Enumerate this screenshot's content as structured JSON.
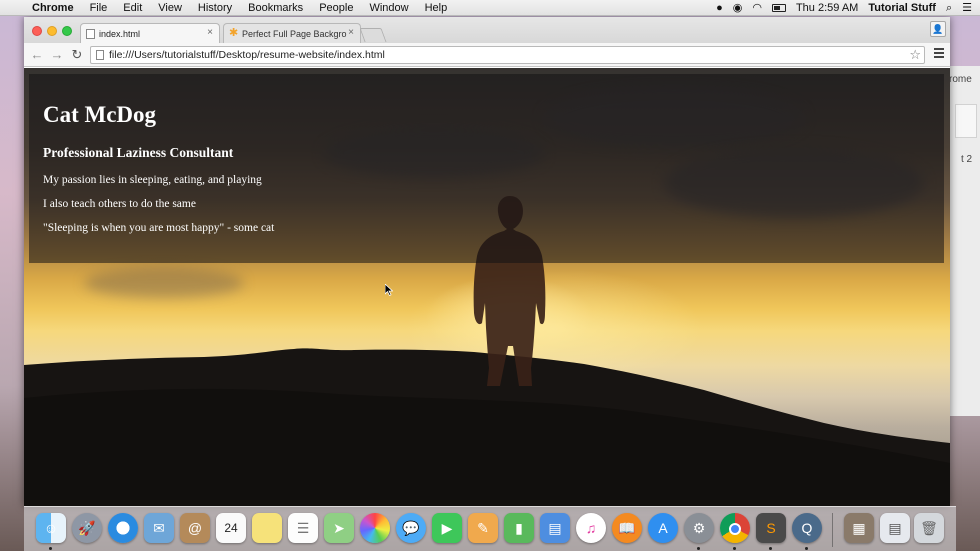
{
  "menubar": {
    "app_name": "Chrome",
    "menus": [
      "File",
      "Edit",
      "View",
      "History",
      "Bookmarks",
      "People",
      "Window",
      "Help"
    ],
    "clock": "Thu 2:59 AM",
    "user": "Tutorial Stuff"
  },
  "browser": {
    "tabs": [
      {
        "title": "index.html",
        "close": "×"
      },
      {
        "title": "Perfect Full Page Backgro",
        "close": "×"
      }
    ],
    "address": "file:///Users/tutorialstuff/Desktop/resume-website/index.html"
  },
  "page": {
    "name": "Cat McDog",
    "role": "Professional Laziness Consultant",
    "lines": [
      "My passion lies in sleeping, eating, and playing",
      "I also teach others to do the same",
      "\"Sleeping is when you are most happy\" - some cat"
    ]
  },
  "background_window": {
    "text1": "rome",
    "text2": "t 2"
  },
  "dock": {
    "calendar_day": "24",
    "items": [
      "finder-icon",
      "launchpad-icon",
      "safari-icon",
      "mail-icon",
      "contacts-icon",
      "calendar-icon",
      "notes-icon",
      "reminders-icon",
      "maps-icon",
      "photos-icon",
      "messages-icon",
      "facetime-icon",
      "pages-icon",
      "numbers-icon",
      "keynote-icon",
      "itunes-icon",
      "ibooks-icon",
      "app-store-icon",
      "system-preferences-icon",
      "chrome-icon",
      "sublime-text-icon",
      "quicktime-icon",
      "downloads-stack-icon",
      "documents-stack-icon",
      "trash-icon"
    ]
  },
  "colors": {
    "close": "#fc5f57",
    "minimize": "#fdbc2e",
    "maximize": "#34c84a"
  }
}
